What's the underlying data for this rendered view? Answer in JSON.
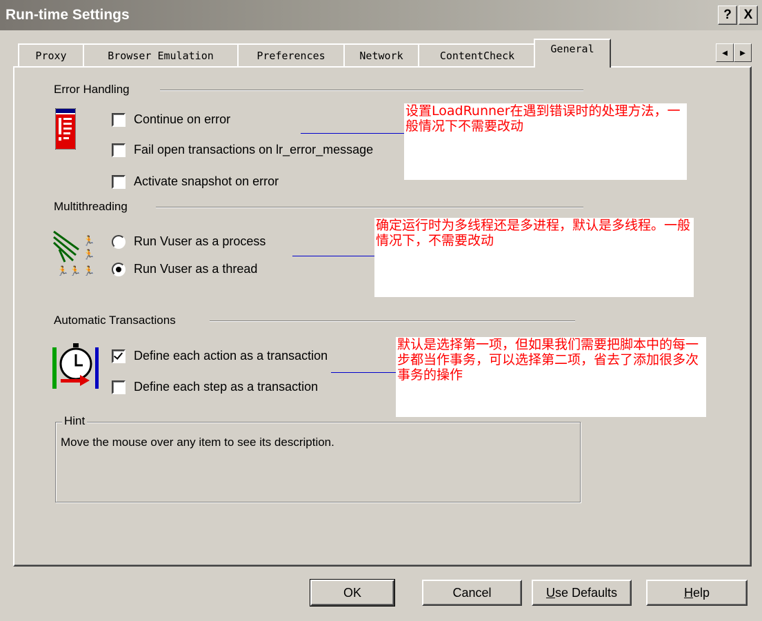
{
  "window": {
    "title": "Run-time Settings",
    "help_btn": "?",
    "close_btn": "X"
  },
  "tabs": [
    {
      "label": "Proxy"
    },
    {
      "label": "Browser Emulation"
    },
    {
      "label": "Preferences"
    },
    {
      "label": "Network"
    },
    {
      "label": "ContentCheck"
    },
    {
      "label": "General",
      "active": true
    }
  ],
  "tab_scroll": {
    "left": "◄",
    "right": "►"
  },
  "error_handling": {
    "title": "Error Handling",
    "icon": "error-list-icon",
    "options": [
      {
        "label": "Continue on error",
        "checked": false
      },
      {
        "label": "Fail open transactions on lr_error_message",
        "checked": false
      },
      {
        "label": "Activate snapshot on error",
        "checked": false
      }
    ]
  },
  "multithreading": {
    "title": "Multithreading",
    "icon": "vuser-threads-icon",
    "options": [
      {
        "label": "Run Vuser as a process",
        "selected": false
      },
      {
        "label": "Run Vuser as a thread",
        "selected": true
      }
    ]
  },
  "auto_transactions": {
    "title": "Automatic Transactions",
    "icon": "stopwatch-icon",
    "options": [
      {
        "label": "Define each action as a transaction",
        "checked": true
      },
      {
        "label": "Define each step as a transaction",
        "checked": false
      }
    ]
  },
  "hint": {
    "title": "Hint",
    "text": "Move the mouse over any item to see its description."
  },
  "buttons": {
    "ok": "OK",
    "cancel": "Cancel",
    "use_defaults": "Use Defaults",
    "help": "Help"
  },
  "annotations": {
    "error": "设置LoadRunner在遇到错误时的处理方法，一般情况下不需要改动",
    "thread": "确定运行时为多线程还是多进程，默认是多线程。一般情况下，不需要改动",
    "transaction": "默认是选择第一项，但如果我们需要把脚本中的每一步都当作事务，可以选择第二项，省去了添加很多次事务的操作"
  },
  "colors": {
    "dialog_bg": "#d4d0c8",
    "annotation_text": "#ff0000",
    "connector": "#0000cc"
  }
}
